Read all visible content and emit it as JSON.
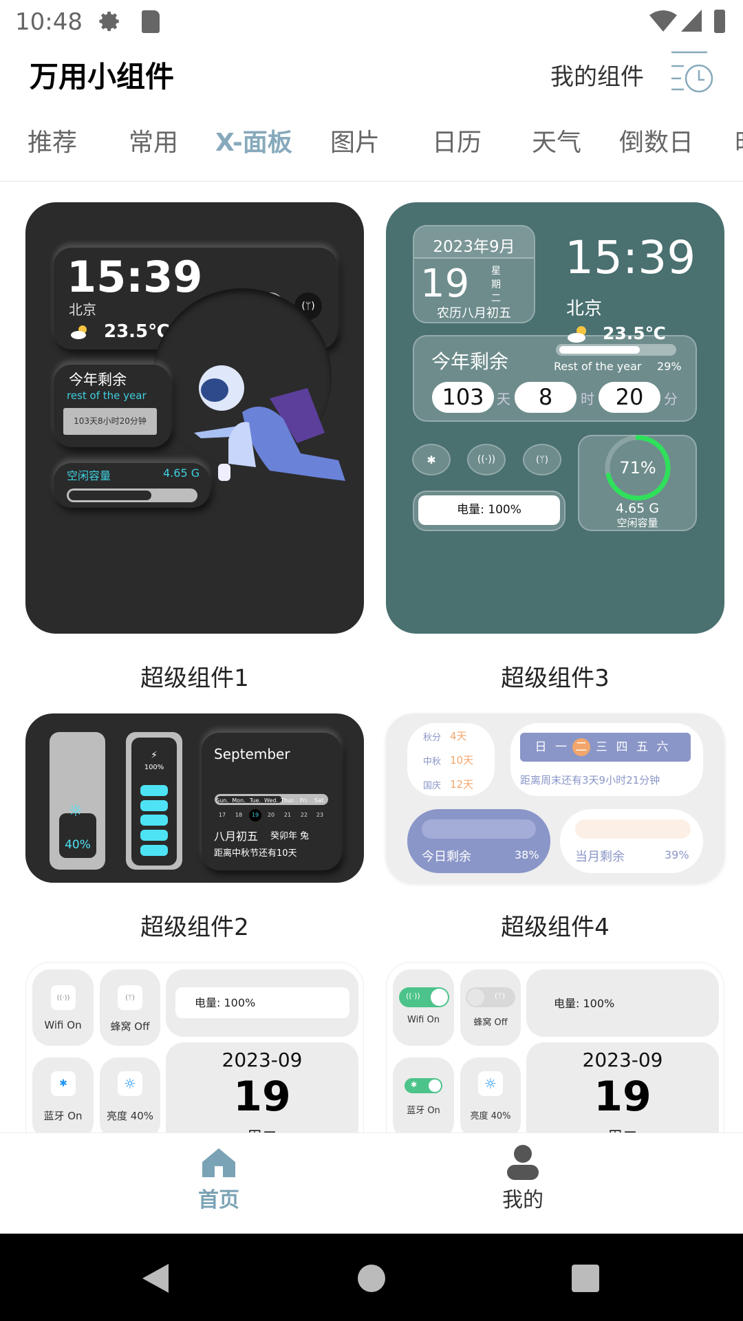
{
  "status_bar": {
    "time": "10:48",
    "icons": [
      "gear-icon",
      "sd-card-icon",
      "wifi-icon",
      "cell-signal-icon",
      "battery-icon"
    ]
  },
  "header": {
    "title": "万用小组件",
    "my_widgets": "我的组件",
    "history_icon": "list-clock-icon"
  },
  "tabs": [
    {
      "label": "推荐"
    },
    {
      "label": "常用"
    },
    {
      "label": "X-面板",
      "active": true
    },
    {
      "label": "图片"
    },
    {
      "label": "日历"
    },
    {
      "label": "天气"
    },
    {
      "label": "倒数日"
    },
    {
      "label": "时"
    }
  ],
  "accent_color": "#86a9bb",
  "widgets": {
    "w1": {
      "label": "超级组件1",
      "time": "15:39",
      "city": "北京",
      "temp": "23.5℃",
      "year_title": "今年剩余",
      "year_sub": "rest of the year",
      "year_remaining": "103天8小时20分钟",
      "storage_label": "空闲容量",
      "storage_value": "4.65 G",
      "storage_fill": 0.65
    },
    "w3": {
      "label": "超级组件3",
      "month": "2023年9月",
      "day": "19",
      "weekday": [
        "星",
        "期",
        "二"
      ],
      "lunar": "农历八月初五",
      "time": "15:39",
      "city": "北京",
      "temp": "23.5℃",
      "year_title": "今年剩余",
      "year_sub": "Rest of the year",
      "year_pct": "29%",
      "year_fill": 0.71,
      "days": "103",
      "days_unit": "天",
      "hours": "8",
      "hours_unit": "时",
      "mins": "20",
      "mins_unit": "分",
      "battery": "电量: 100%",
      "ring_pct": "71%",
      "ring_value": 0.71,
      "storage_value": "4.65 G",
      "storage_label": "空闲容量"
    },
    "w2": {
      "label": "超级组件2",
      "brightness": "40%",
      "battery": "100%",
      "battery_bars": 5,
      "month": "September",
      "month_fill": 0.6,
      "weekdays": [
        "Sun.",
        "Mon.",
        "Tue.",
        "Wed.",
        "Thur.",
        "Fri.",
        "Sat."
      ],
      "dates": [
        "17",
        "18",
        "19",
        "20",
        "21",
        "22",
        "23"
      ],
      "today_index": 2,
      "lunar": "八月初五",
      "ganzhi": "癸卯年 兔",
      "countdown": "距离中秋节还有10天"
    },
    "w4": {
      "label": "超级组件4",
      "holidays": [
        {
          "name": "秋分",
          "days": "4天"
        },
        {
          "name": "中秋",
          "days": "10天"
        },
        {
          "name": "国庆",
          "days": "12天"
        }
      ],
      "week": [
        "日",
        "一",
        "二",
        "三",
        "四",
        "五",
        "六"
      ],
      "today_index": 2,
      "weekend": "距离周末还有3天9小时21分钟",
      "today_label": "今日剩余",
      "today_pct": "38%",
      "month_label": "当月剩余",
      "month_pct": "39%"
    },
    "w5": {
      "wifi": "Wifi On",
      "cell": "蜂窝 Off",
      "bt": "蓝牙 On",
      "bright": "亮度 40%",
      "battery": "电量: 100%",
      "ym": "2023-09",
      "day": "19",
      "weekday": "周二"
    },
    "w6": {
      "wifi": "Wifi On",
      "cell": "蜂窝 Off",
      "bt": "蓝牙 On",
      "bright": "亮度 40%",
      "battery": "电量: 100%",
      "ym": "2023-09",
      "day": "19",
      "weekday": "周二"
    }
  },
  "bottom_nav": [
    {
      "label": "首页",
      "icon": "home-icon",
      "active": true
    },
    {
      "label": "我的",
      "icon": "person-icon"
    }
  ]
}
